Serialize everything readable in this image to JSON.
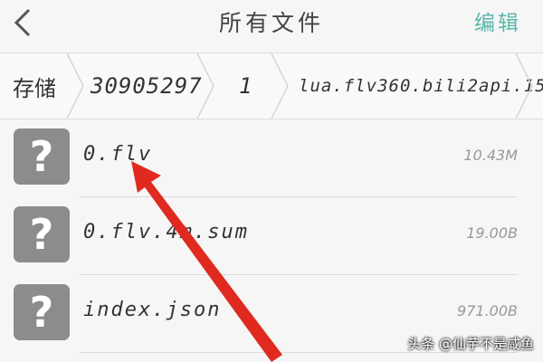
{
  "header": {
    "back_icon": "chevron-left-icon",
    "title": "所有文件",
    "edit_label": "编辑",
    "edit_color": "#58b8a8"
  },
  "breadcrumb": {
    "items": [
      "存储",
      "30905297",
      "1",
      "lua.flv360.bili2api.15"
    ],
    "separator_icon": "chevron-right-icon"
  },
  "files": [
    {
      "name": "0.flv",
      "size": "10.43M",
      "icon": "unknown-file-icon"
    },
    {
      "name": "0.flv.4m.sum",
      "size": "19.00B",
      "icon": "unknown-file-icon"
    },
    {
      "name": "index.json",
      "size": "971.00B",
      "icon": "unknown-file-icon"
    }
  ],
  "annotation": {
    "icon": "red-arrow-icon",
    "color": "#e02a1f"
  },
  "watermark": "头条 @仙芋不是咸鱼"
}
